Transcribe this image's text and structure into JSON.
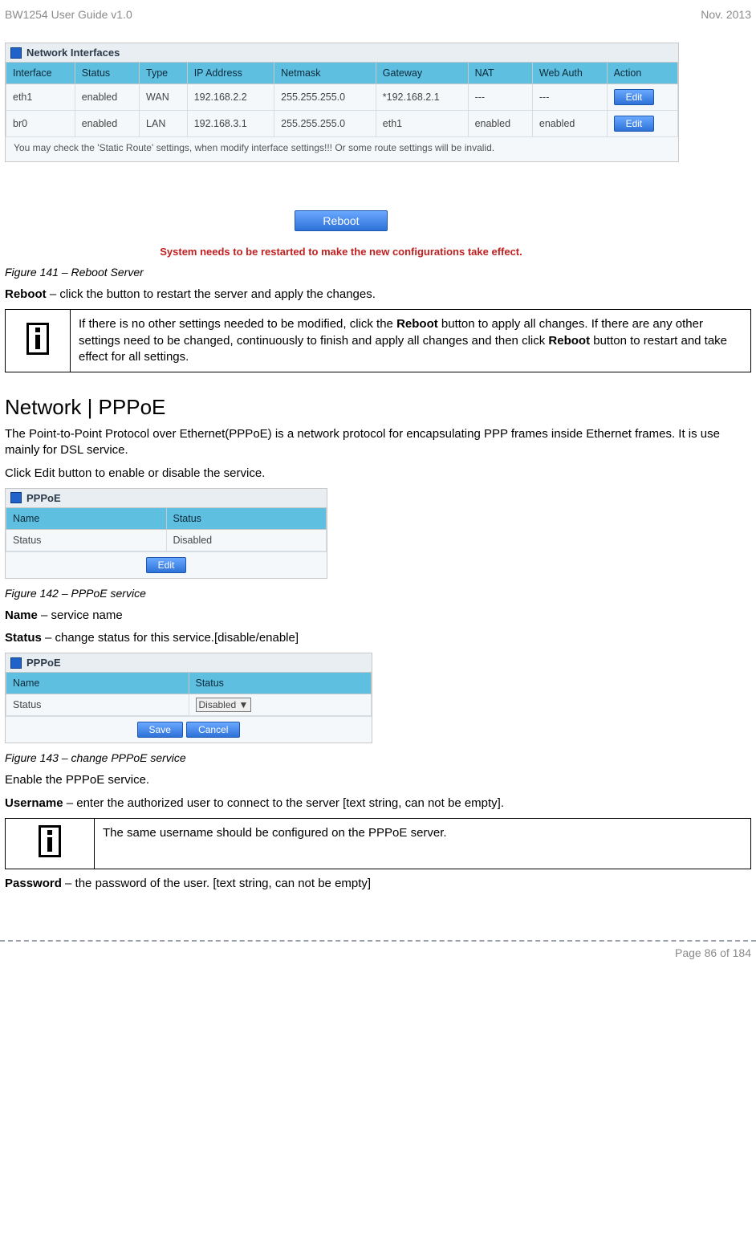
{
  "header": {
    "left": "BW1254 User Guide v1.0",
    "right": "Nov.  2013"
  },
  "panel1": {
    "title": "Network Interfaces",
    "columns": [
      "Interface",
      "Status",
      "Type",
      "IP Address",
      "Netmask",
      "Gateway",
      "NAT",
      "Web Auth",
      "Action"
    ],
    "rows": [
      {
        "cells": [
          "eth1",
          "enabled",
          "WAN",
          "192.168.2.2",
          "255.255.255.0",
          "*192.168.2.1",
          "---",
          "---"
        ],
        "action": "Edit"
      },
      {
        "cells": [
          "br0",
          "enabled",
          "LAN",
          "192.168.3.1",
          "255.255.255.0",
          "eth1",
          "enabled",
          "enabled"
        ],
        "action": "Edit"
      }
    ],
    "footnote": "You may check the 'Static Route' settings, when modify interface settings!!! Or some route settings will be invalid."
  },
  "reboot": {
    "button": "Reboot",
    "msg": "System needs to be restarted to make the new configurations take effect."
  },
  "fig141": "Figure 141 – Reboot Server",
  "line_reboot_desc_b": "Reboot",
  "line_reboot_desc": " – click the button to restart the server and apply the changes.",
  "note1_pre": "If there is no other settings needed to be modified, click the ",
  "note1_b1": "Reboot",
  "note1_mid": " button to apply all changes. If there are any other settings need to be changed, continuously to finish and apply all changes and then click ",
  "note1_b2": "Reboot",
  "note1_post": " button to restart and take effect  for all settings.",
  "sectionTitle": "Network | PPPoE",
  "pppoe_intro": "The Point-to-Point Protocol over Ethernet(PPPoE) is a network protocol for encapsulating PPP frames inside Ethernet frames. It is use mainly for DSL service.",
  "pppoe_click": "Click Edit button to enable or disable the service.",
  "panel2": {
    "title": "PPPoE",
    "columns": [
      "Name",
      "Status"
    ],
    "rows": [
      {
        "cells": [
          "Status",
          "Disabled"
        ]
      }
    ],
    "button": "Edit"
  },
  "fig142": "Figure 142 – PPPoE service",
  "name_b": "Name",
  "name_t": " – service name",
  "status_b": "Status",
  "status_t": " – change status for this service.[disable/enable]",
  "panel3": {
    "title": "PPPoE",
    "columns": [
      "Name",
      "Status"
    ],
    "row_label": "Status",
    "select_value": "Disabled",
    "save": "Save",
    "cancel": "Cancel"
  },
  "fig143": "Figure 143 – change PPPoE service",
  "enable_line": "Enable the PPPoE service.",
  "username_b": "Username",
  "username_t": " – enter the authorized user to connect to the server [text string, can not be empty].",
  "note2": "The same username should be configured on the PPPoE server.",
  "password_b": "Password",
  "password_t": " – the password of the user. [text string, can not be empty]",
  "footer": "Page 86 of 184"
}
